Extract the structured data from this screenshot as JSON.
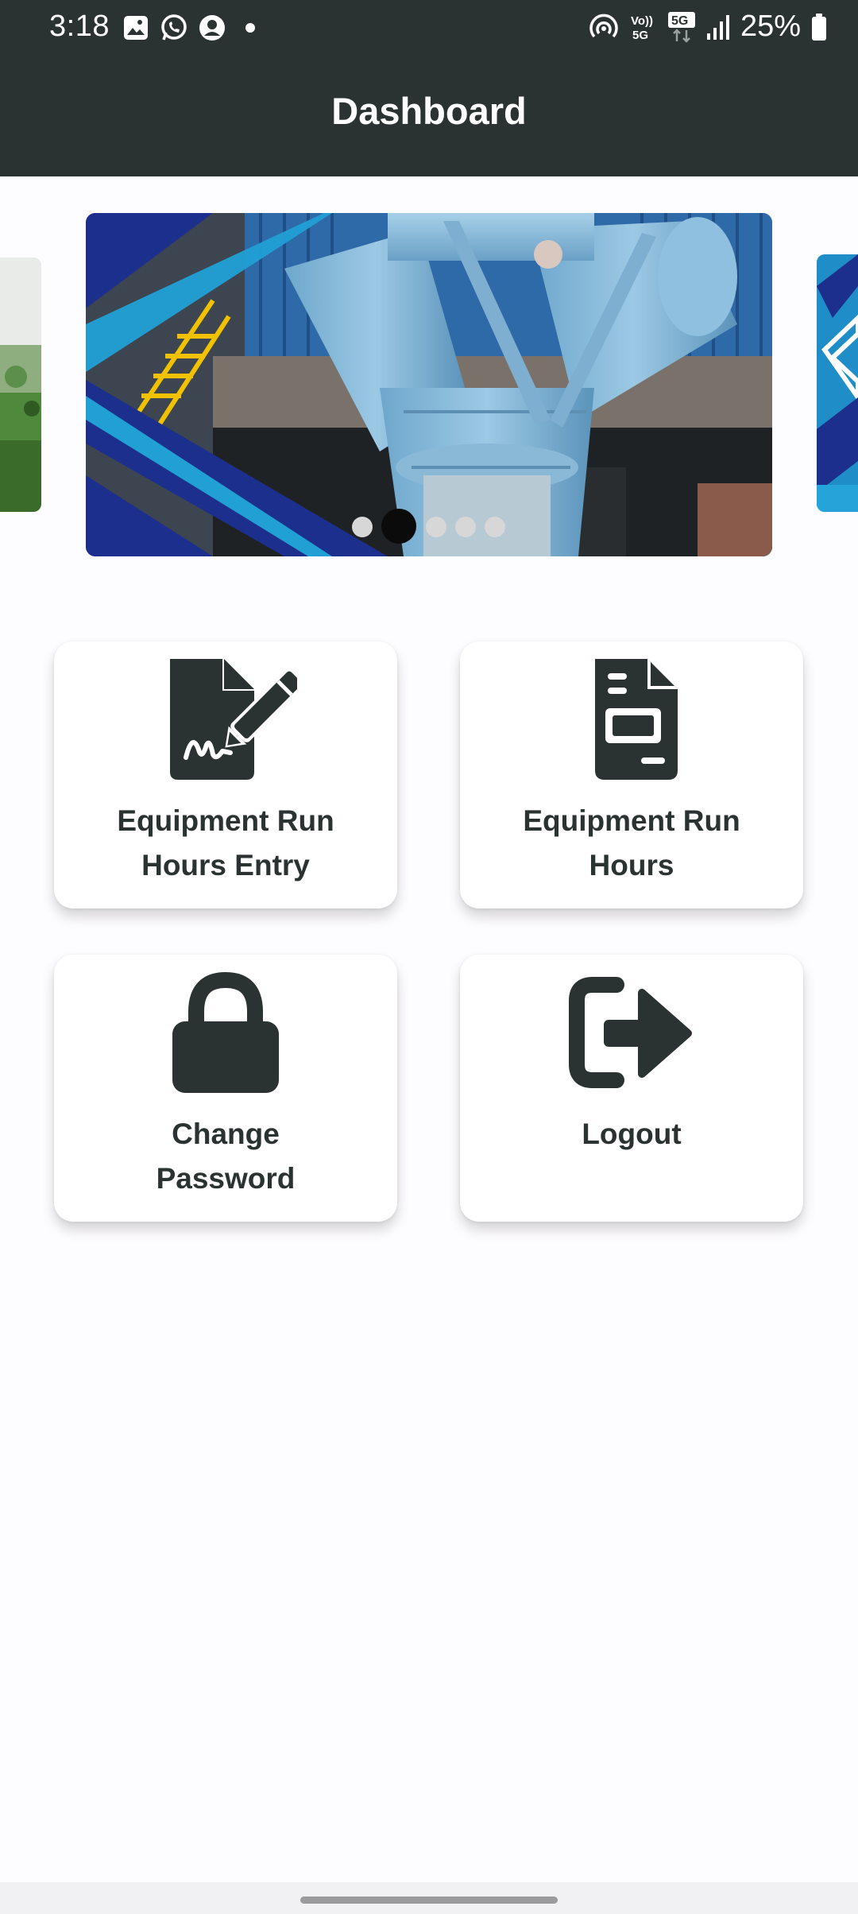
{
  "status_bar": {
    "time": "3:18",
    "left_icons": [
      "gallery-icon",
      "whatsapp-icon",
      "account-icon",
      "dot-icon"
    ],
    "right_icons": [
      "hotspot-icon",
      "volte-icon",
      "5g-icon",
      "signal-icon",
      "battery-icon"
    ],
    "volte_label": "Vo)) 5G",
    "network_label": "5G",
    "battery": "25%"
  },
  "header": {
    "title": "Dashboard"
  },
  "carousel": {
    "slides": 5,
    "active_index": 1
  },
  "tiles": [
    {
      "label_line1": "Equipment Run",
      "label_line2": "Hours Entry",
      "icon": "signed-document-icon"
    },
    {
      "label_line1": "Equipment Run",
      "label_line2": "Hours",
      "icon": "document-icon"
    },
    {
      "label_line1": "Change",
      "label_line2": "Password",
      "icon": "lock-icon"
    },
    {
      "label_line1": "Logout",
      "icon": "logout-icon"
    }
  ],
  "colors": {
    "header_bg": "#2a3331",
    "icon_color": "#2a3331",
    "page_bg": "#fdfcfe",
    "slide_blue": "#1e8bc3",
    "slide_navy": "#1d2f8c"
  }
}
